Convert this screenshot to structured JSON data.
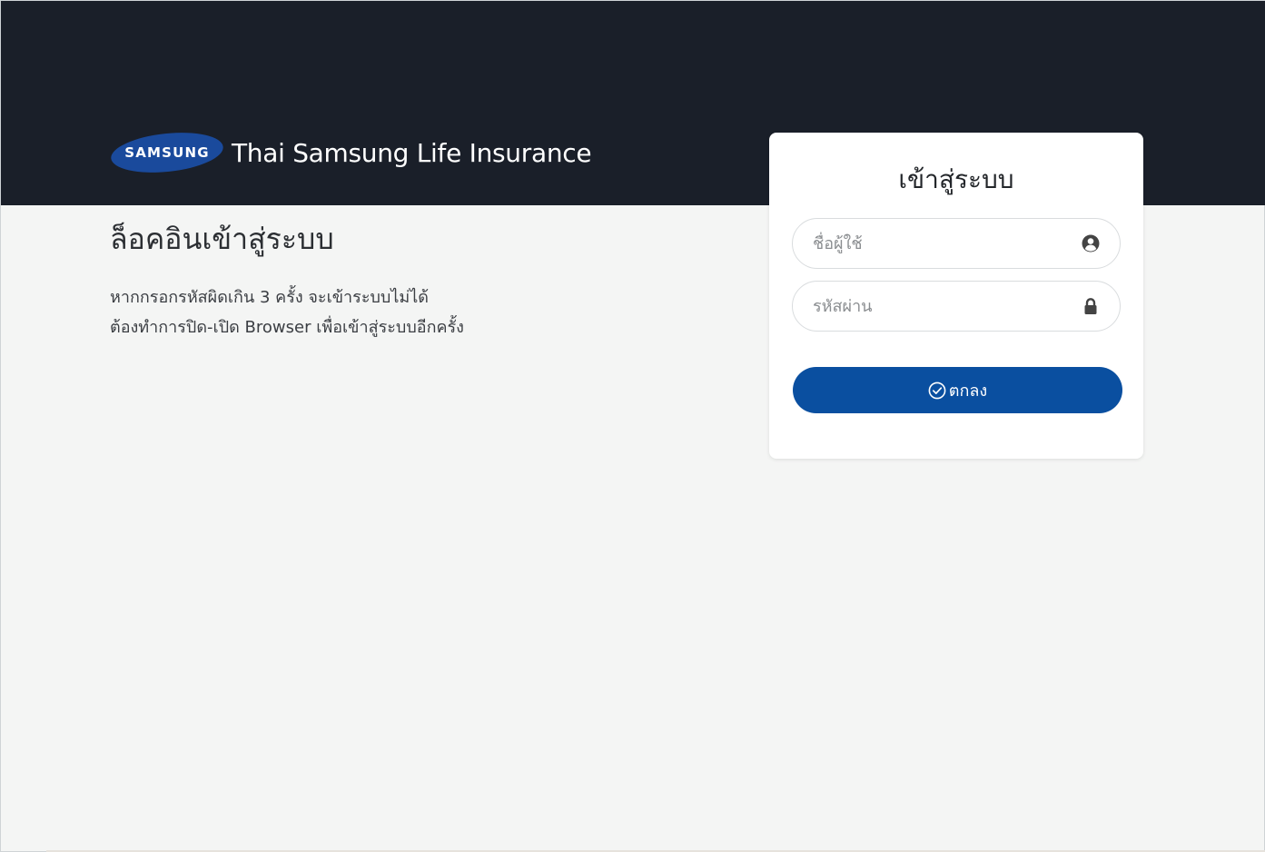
{
  "header": {
    "logo_text": "SAMSUNG",
    "brand_name": "Thai Samsung Life Insurance"
  },
  "intro": {
    "title": "ล็อคอินเข้าสู่ระบบ",
    "line1": "หากกรอกรหัสผิดเกิน 3 ครั้ง จะเข้าระบบไม่ได้",
    "line2": "ต้องทำการปิด-เปิด Browser เพื่อเข้าสู่ระบบอีกครั้ง"
  },
  "login": {
    "title": "เข้าสู่ระบบ",
    "username_placeholder": "ชื่อผู้ใช้",
    "username_value": "",
    "password_placeholder": "รหัสผ่าน",
    "password_value": "",
    "submit_label": "ตกลง",
    "username_icon": "user-circle-icon",
    "password_icon": "lock-icon",
    "submit_icon": "check-circle-icon"
  },
  "colors": {
    "header_bg": "#1a1f29",
    "page_bg": "#f4f5f4",
    "brand_blue": "#0a4fa0",
    "logo_blue": "#1a4a9c"
  }
}
